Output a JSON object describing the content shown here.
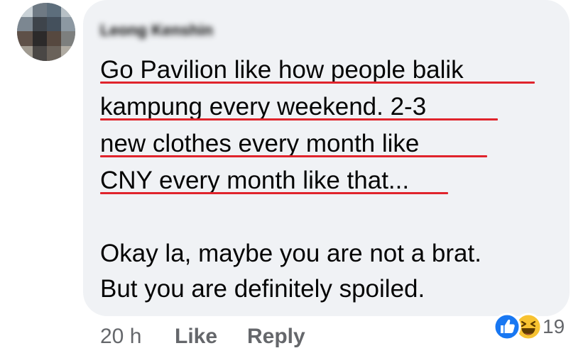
{
  "comment": {
    "author_name": "Leong Kenshin",
    "text_lines": [
      "Go Pavilion like how people balik",
      "kampung every weekend. 2-3",
      "new clothes every month like",
      "CNY every month like that...",
      "Okay la, maybe you are not a brat.",
      "But you are definitely spoiled."
    ]
  },
  "footer": {
    "timestamp": "20 h",
    "like_label": "Like",
    "reply_label": "Reply"
  },
  "reactions": {
    "types": [
      "like-icon",
      "haha-icon"
    ],
    "count": "19",
    "like_color": "#1877f2",
    "haha_color": "#f7c231"
  },
  "annotation": {
    "underline_color": "#e0242c"
  }
}
